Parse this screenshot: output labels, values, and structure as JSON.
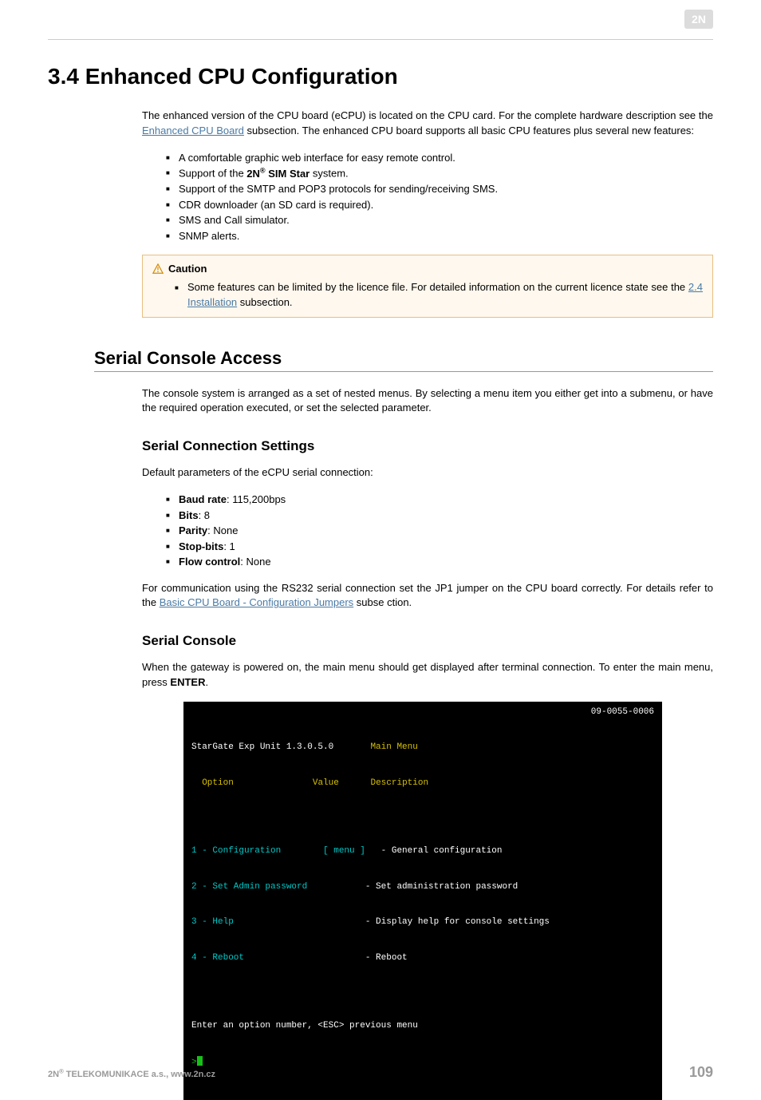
{
  "brand": "2N",
  "h1": "3.4 Enhanced CPU Configuration",
  "intro": {
    "p1a": "The enhanced version of the CPU board (eCPU) is located on the CPU card. For the complete hardware description see the ",
    "link1": "Enhanced CPU Board",
    "p1b": " subsection. The enhanced CPU board supports all basic CPU features plus several new features:",
    "sim_star_a": "Support of the ",
    "sim_star_b_brand": "2N",
    "sim_star_c": " SIM Star",
    "sim_star_d": " system.",
    "items": {
      "i1": "A comfortable graphic web interface for easy remote control.",
      "i3": "Support of the SMTP and POP3 protocols for sending/receiving SMS.",
      "i4": "CDR downloader (an SD card is required).",
      "i5": "SMS and Call simulator.",
      "i6": "SNMP alerts."
    }
  },
  "callout": {
    "title": "Caution",
    "li_a": "Some features can be limited by the licence file. For detailed information on the current licence state see the ",
    "link": "2.4 Installation",
    "li_b": " subsection."
  },
  "serial_access": {
    "h2": "Serial Console Access",
    "p": "The console system is arranged as a set of nested menus. By selecting a menu item you either get into a submenu, or have the required operation executed, or set the selected parameter."
  },
  "conn": {
    "h3": "Serial Connection Settings",
    "p": "Default parameters of the eCPU serial connection:",
    "items": {
      "i1b": "Baud rate",
      "i1v": ": 115,200bps",
      "i2b": "Bits",
      "i2v": ": 8",
      "i3b": "Parity",
      "i3v": ": None",
      "i4b": "Stop-bits",
      "i4v": ": 1",
      "i5b": "Flow control",
      "i5v": ": None"
    },
    "p2a": "For communication using the RS232 serial connection set the JP1 jumper on the CPU board correctly. For details refer to the ",
    "link": "Basic CPU Board - Configuration Jumpers",
    "p2b": " subse ction."
  },
  "console": {
    "h3": "Serial Console",
    "p_a": "When the gateway is powered on, the main menu should get displayed after terminal connection. To enter the main menu, press ",
    "p_b": "ENTER",
    "p_c": "."
  },
  "term": {
    "title": "StarGate Exp Unit 1.3.0.5.0",
    "centre": "Main Menu",
    "serial": "09-0055-0006",
    "h_option": "  Option",
    "h_value": "Value",
    "h_desc": "Description",
    "r1a": "1 - Configuration        [ menu ]",
    "r1b": "   - General configuration",
    "r2a": "2 - Set Admin password",
    "r2b": "           - Set administration password",
    "r3a": "3 - Help",
    "r3b": "                         - Display help for console settings",
    "r4a": "4 - Reboot",
    "r4b": "                       - Reboot",
    "prompt": "Enter an option number, <ESC> previous menu",
    "cursor": ">"
  },
  "footer": {
    "left_a": "2N",
    "left_b": " TELEKOMUNIKACE a.s., www.2n.cz",
    "page": "109"
  }
}
